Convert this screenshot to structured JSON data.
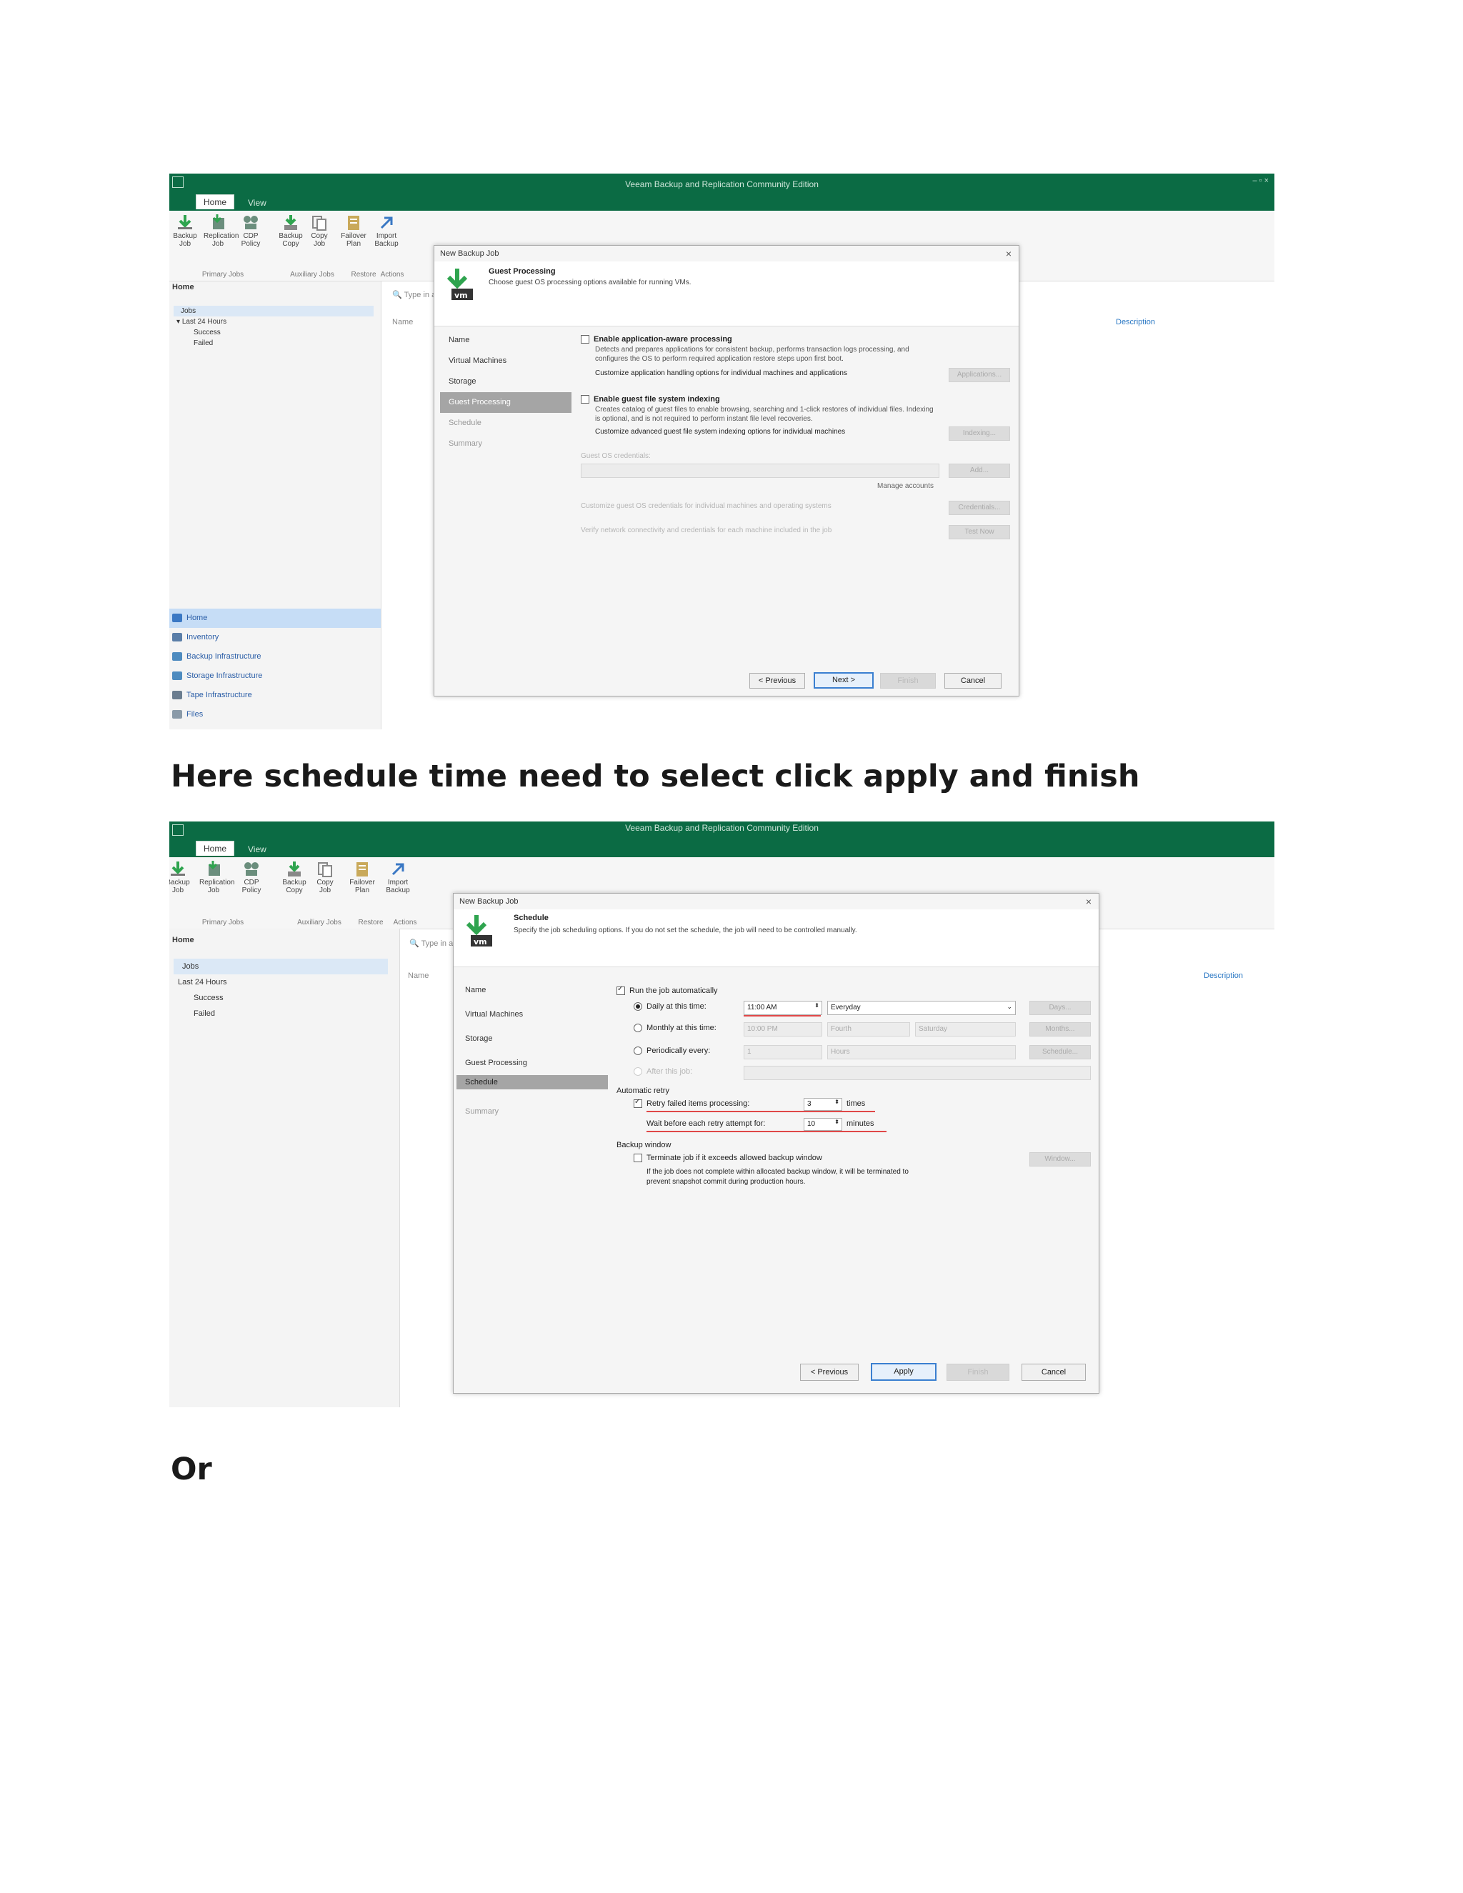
{
  "heading_1": "Here schedule time need to select click apply and finish",
  "heading_2": "Or",
  "colors": {
    "app_green": "#0b6b44",
    "selection_blue": "#c6ddf6",
    "link_blue": "#2b78c4",
    "annotation_red": "#e04848"
  },
  "app": {
    "title": "Veeam Backup and Replication Community Edition",
    "tabs": [
      "Home",
      "View"
    ],
    "ribbon_buttons": [
      {
        "label": "Backup Job",
        "icon": "backup-job-icon"
      },
      {
        "label": "Replication Job",
        "icon": "replication-job-icon"
      },
      {
        "label": "CDP Policy",
        "icon": "cdp-policy-icon"
      },
      {
        "label": "Backup Copy",
        "icon": "backup-copy-icon"
      },
      {
        "label": "Copy Job",
        "icon": "copy-job-icon"
      },
      {
        "label": "Failover Plan",
        "icon": "failover-plan-icon"
      },
      {
        "label": "Import Backup",
        "icon": "import-backup-icon"
      }
    ],
    "ribbon_groups": [
      "Primary Jobs",
      "Auxiliary Jobs",
      "Restore",
      "Actions"
    ],
    "nav_header": "Home",
    "search_placeholder": "Type in an object name to search for",
    "column_name": "Name",
    "column_description": "Description",
    "tree": [
      "Jobs",
      "Last 24 Hours",
      "Success",
      "Failed"
    ],
    "nav_bottom": [
      "Home",
      "Inventory",
      "Backup Infrastructure",
      "Storage Infrastructure",
      "Tape Infrastructure",
      "Files"
    ]
  },
  "dialog1": {
    "title": "New Backup Job",
    "close": "×",
    "step_title": "Guest Processing",
    "step_subtitle": "Choose guest OS processing options available for running VMs.",
    "steps": [
      "Name",
      "Virtual Machines",
      "Storage",
      "Guest Processing",
      "Schedule",
      "Summary"
    ],
    "selected_step": "Guest Processing",
    "app_aware": {
      "label": "Enable application-aware processing",
      "desc1": "Detects and prepares applications for consistent backup, performs transaction logs processing, and",
      "desc2": "configures the OS to perform required application restore steps upon first boot.",
      "customize": "Customize application handling options for individual machines and applications",
      "button": "Applications..."
    },
    "indexing": {
      "label": "Enable guest file system indexing",
      "desc1": "Creates catalog of guest files to enable browsing, searching and 1-click restores of individual files. Indexing",
      "desc2": "is optional, and is not required to perform instant file level recoveries.",
      "customize": "Customize advanced guest file system indexing options for individual machines",
      "button": "Indexing..."
    },
    "credentials_label": "Guest OS credentials:",
    "add_button": "Add...",
    "manage_accounts": "Manage accounts",
    "customize_creds": "Customize guest OS credentials for individual machines and operating systems",
    "credentials_button": "Credentials...",
    "verify_text": "Verify network connectivity and credentials for each machine included in the job",
    "test_button": "Test Now",
    "buttons": {
      "previous": "< Previous",
      "next": "Next >",
      "finish": "Finish",
      "cancel": "Cancel"
    }
  },
  "dialog2": {
    "title": "New Backup Job",
    "close": "×",
    "step_title": "Schedule",
    "step_subtitle": "Specify the job scheduling options. If you do not set the schedule, the job will need to be controlled manually.",
    "steps": [
      "Name",
      "Virtual Machines",
      "Storage",
      "Guest Processing",
      "Schedule",
      "Summary"
    ],
    "selected_step": "Schedule",
    "run_auto": "Run the job automatically",
    "daily_label": "Daily at this time:",
    "daily_time": "11:00 AM",
    "daily_option": "Everyday",
    "days_button": "Days...",
    "monthly_label": "Monthly at this time:",
    "monthly_time": "10:00 PM",
    "monthly_week": "Fourth",
    "monthly_day": "Saturday",
    "months_button": "Months...",
    "periodic_label": "Periodically every:",
    "periodic_value": "1",
    "periodic_unit": "Hours",
    "schedule_button": "Schedule...",
    "after_job_label": "After this job:",
    "auto_retry_section": "Automatic retry",
    "retry_label": "Retry failed items processing:",
    "retry_value": "3",
    "retry_unit": "times",
    "wait_label": "Wait before each retry attempt for:",
    "wait_value": "10",
    "wait_unit": "minutes",
    "backup_window_section": "Backup window",
    "terminate_label": "Terminate job if it exceeds allowed backup window",
    "window_button": "Window...",
    "terminate_desc1": "If the job does not complete within allocated backup window, it will be terminated to",
    "terminate_desc2": "prevent snapshot commit during production hours.",
    "buttons": {
      "previous": "< Previous",
      "apply": "Apply",
      "finish": "Finish",
      "cancel": "Cancel"
    }
  }
}
